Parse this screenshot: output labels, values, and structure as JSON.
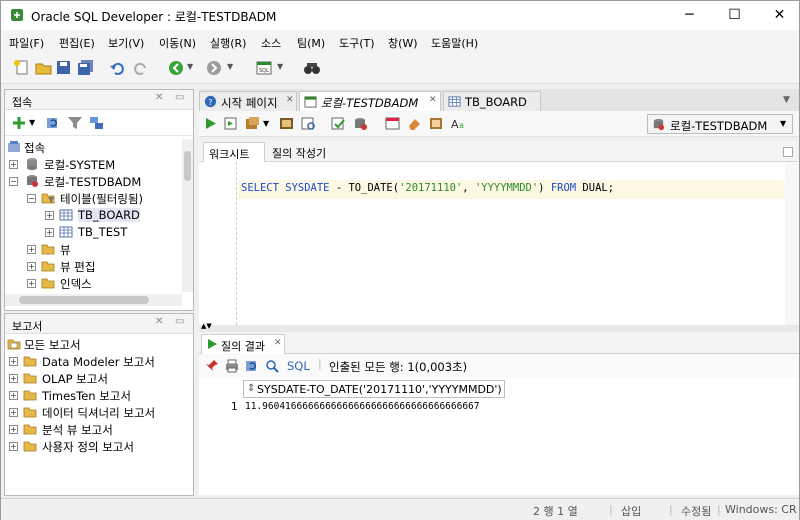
{
  "window": {
    "title": "Oracle SQL Developer : 로컬-TESTDBADM"
  },
  "menu": [
    "파일(F)",
    "편집(E)",
    "보기(V)",
    "이동(N)",
    "실행(R)",
    "소스",
    "팀(M)",
    "도구(T)",
    "창(W)",
    "도움말(H)"
  ],
  "connections_panel": {
    "title": "접속",
    "root": "접속",
    "items": [
      {
        "label": "로컬-SYSTEM"
      },
      {
        "label": "로컬-TESTDBADM"
      },
      {
        "label": "테이블(필터링됨)"
      },
      {
        "label": "TB_BOARD"
      },
      {
        "label": "TB_TEST"
      },
      {
        "label": "뷰"
      },
      {
        "label": "뷰 편집"
      },
      {
        "label": "인덱스"
      }
    ]
  },
  "reports_panel": {
    "title": "보고서",
    "items": [
      {
        "label": "모든 보고서"
      },
      {
        "label": "Data Modeler 보고서"
      },
      {
        "label": "OLAP 보고서"
      },
      {
        "label": "TimesTen 보고서"
      },
      {
        "label": "데이터 딕셔너리 보고서"
      },
      {
        "label": "분석 뷰 보고서"
      },
      {
        "label": "사용자 정의 보고서"
      }
    ]
  },
  "tabs": [
    {
      "label": "시작 페이지"
    },
    {
      "label": "로컬-TESTDBADM"
    },
    {
      "label": "TB_BOARD"
    }
  ],
  "connection_selector": {
    "value": "로컬-TESTDBADM"
  },
  "subtabs": {
    "worksheet": "워크시트",
    "query_builder": "질의 작성기"
  },
  "editor": {
    "tokens": [
      {
        "t": "SELECT SYSDATE",
        "c": "k"
      },
      {
        "t": " - TO_DATE(",
        "c": ""
      },
      {
        "t": "'20171110'",
        "c": "s"
      },
      {
        "t": ", ",
        "c": ""
      },
      {
        "t": "'YYYYMMDD'",
        "c": "s"
      },
      {
        "t": ") ",
        "c": ""
      },
      {
        "t": "FROM",
        "c": "k"
      },
      {
        "t": " DUAL;",
        "c": ""
      }
    ]
  },
  "results": {
    "tab_label": "질의 결과",
    "sql_label": "SQL",
    "fetched_text": "인출된 모든 행: 1(0,003초)",
    "column": "SYSDATE-TO_DATE('20171110','YYYYMMDD')",
    "rows": [
      {
        "num": "1",
        "value": "11.96041666666666666666666666666666666667"
      }
    ]
  },
  "status": {
    "position": "2 행 1 열",
    "mode": "삽입",
    "modified": "수정됨",
    "line_ending": "Windows: CR"
  }
}
